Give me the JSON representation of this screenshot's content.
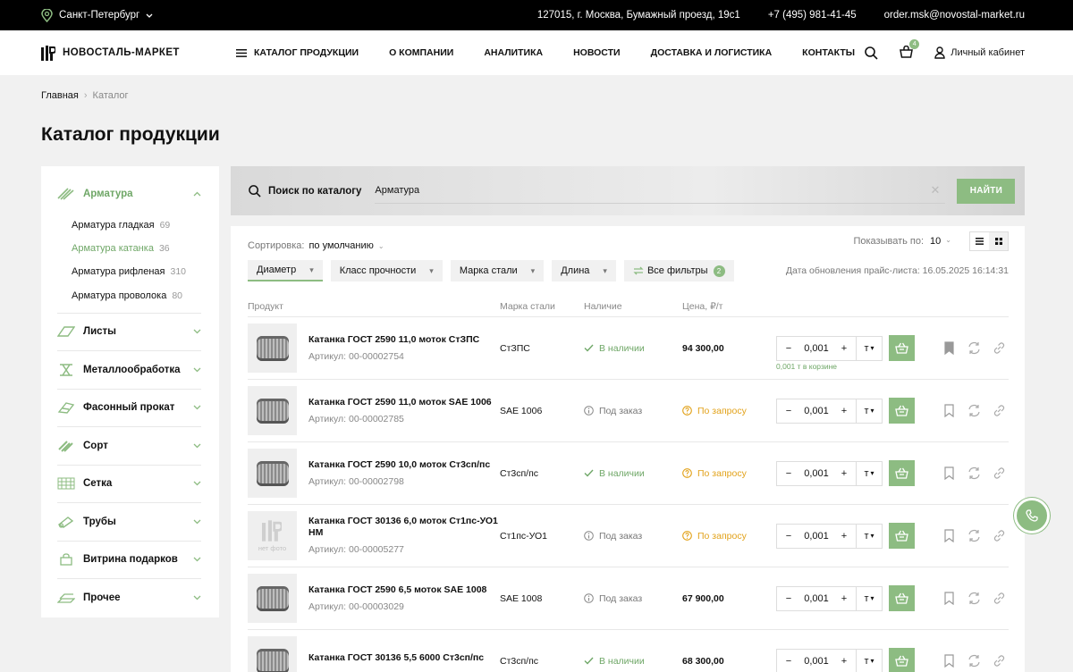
{
  "topbar": {
    "city": "Санкт-Петербург",
    "address": "127015, г. Москва, Бумажный проезд, 19с1",
    "phone": "+7 (495) 981-41-45",
    "email": "order.msk@novostal-market.ru"
  },
  "header": {
    "logo_text": "НОВОСТАЛЬ-МАРКЕТ",
    "nav": [
      "КАТАЛОГ ПРОДУКЦИИ",
      "О КОМПАНИИ",
      "АНАЛИТИКА",
      "НОВОСТИ",
      "ДОСТАВКА И ЛОГИСТИКА",
      "КОНТАКТЫ"
    ],
    "cart_count": "4",
    "cabinet_label": "Личный кабинет"
  },
  "breadcrumbs": [
    "Главная",
    "Каталог"
  ],
  "page_title": "Каталог продукции",
  "sidebar": {
    "active_category": "Арматура",
    "subcategories": [
      {
        "name": "Арматура гладкая",
        "count": "69"
      },
      {
        "name": "Арматура катанка",
        "count": "36"
      },
      {
        "name": "Арматура рифленая",
        "count": "310"
      },
      {
        "name": "Арматура проволока",
        "count": "80"
      }
    ],
    "categories": [
      "Листы",
      "Металлообработка",
      "Фасонный прокат",
      "Сорт",
      "Сетка",
      "Трубы",
      "Витрина подарков",
      "Прочее"
    ]
  },
  "search": {
    "label": "Поиск по каталогу",
    "value": "Арматура",
    "button": "НАЙТИ"
  },
  "controls": {
    "sort_label": "Сортировка:",
    "sort_value": "по умолчанию",
    "show_label": "Показывать по:",
    "show_value": "10",
    "filters": [
      "Диаметр",
      "Класс прочности",
      "Марка стали",
      "Длина"
    ],
    "all_filters": "Все фильтры",
    "all_filters_count": "2",
    "updated": "Дата обновления прайс-листа: 16.05.2025 16:14:31"
  },
  "table": {
    "headers": [
      "Продукт",
      "Марка стали",
      "Наличие",
      "Цена, ₽/т"
    ],
    "rows": [
      {
        "name": "Катанка ГОСТ 2590 11,0 моток СтЗПС",
        "article": "Артикул: 00-00002754",
        "mark": "СтЗПС",
        "stock": "В наличии",
        "price": "94 300,00",
        "qty": "0,001",
        "unit": "т",
        "in_cart": "0,001 т в корзине"
      },
      {
        "name": "Катанка ГОСТ 2590 11,0 моток SAE 1006",
        "article": "Артикул: 00-00002785",
        "mark": "SAE 1006",
        "stock": "Под заказ",
        "price": "По запросу",
        "qty": "0,001",
        "unit": "т"
      },
      {
        "name": "Катанка ГОСТ 2590 10,0 моток Ст3сп/пс",
        "article": "Артикул: 00-00002798",
        "mark": "Ст3сп/пс",
        "stock": "В наличии",
        "price": "По запросу",
        "qty": "0,001",
        "unit": "т"
      },
      {
        "name": "Катанка ГОСТ 30136 6,0 моток Ст1пс-УО1 НМ",
        "article": "Артикул: 00-00005277",
        "mark": "Ст1пс-УО1",
        "stock": "Под заказ",
        "price": "По запросу",
        "qty": "0,001",
        "unit": "т",
        "no_photo": "нет фото"
      },
      {
        "name": "Катанка ГОСТ 2590 6,5 моток SAE 1008",
        "article": "Артикул: 00-00003029",
        "mark": "SAE 1008",
        "stock": "Под заказ",
        "price": "67 900,00",
        "qty": "0,001",
        "unit": "т"
      },
      {
        "name": "Катанка ГОСТ 30136 5,5 6000 Ст3сп/пс",
        "article": "",
        "mark": "Ст3сп/пс",
        "stock": "В наличии",
        "price": "68 300,00",
        "qty": "0,001",
        "unit": "т"
      }
    ]
  },
  "colors": {
    "accent": "#8dbc82",
    "accent_text": "#6fa767",
    "warning": "#e2a21a"
  }
}
